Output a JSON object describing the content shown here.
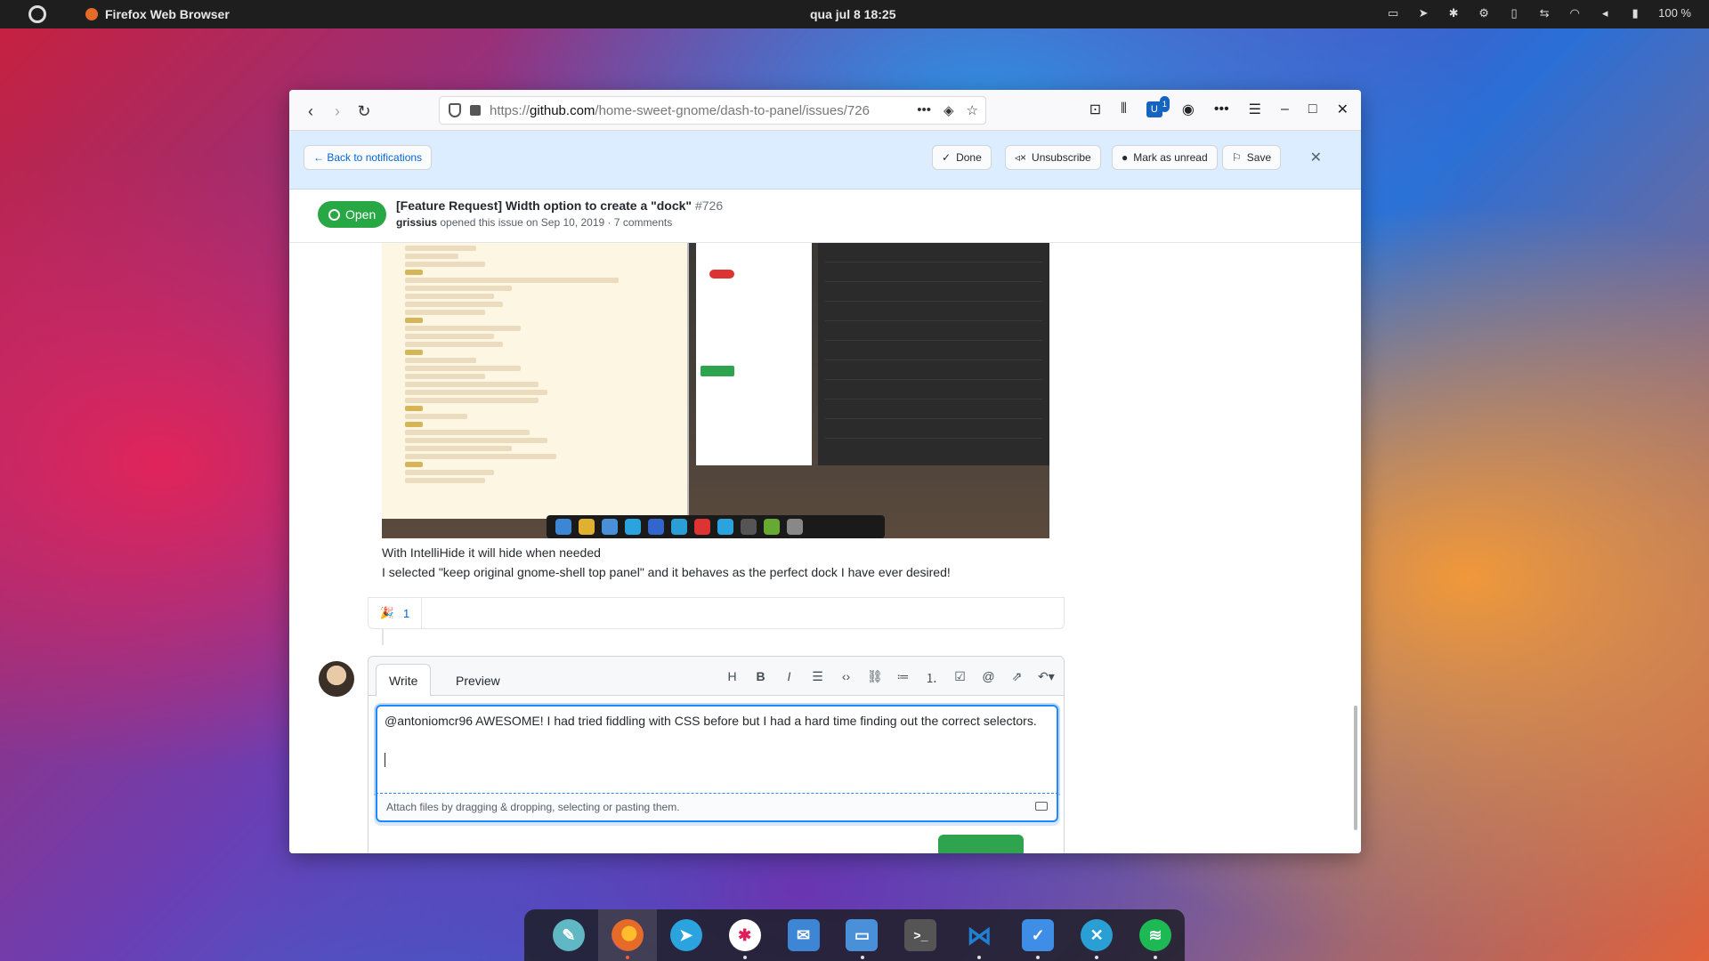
{
  "topbar": {
    "app_name": "Firefox Web Browser",
    "clock": "qua jul 8  18:25",
    "battery": "100 %"
  },
  "browser": {
    "url_prefix": "https://",
    "url_domain": "github.com",
    "url_path": "/home-sweet-gnome/dash-to-panel/issues/726",
    "extension_badge": "1"
  },
  "notifications": {
    "back": "← Back to notifications",
    "done": "Done",
    "unsubscribe": "Unsubscribe",
    "mark_unread": "Mark as unread",
    "save": "Save"
  },
  "issue": {
    "state": "Open",
    "title": "[Feature Request] Width option to create a \"dock\"",
    "number": "#726",
    "author": "grissius",
    "meta": "opened this issue on Sep 10, 2019 · 7 comments"
  },
  "comment": {
    "line1": "With IntelliHide it will hide when needed",
    "line2": "I selected \"keep original gnome-shell top panel\" and it behaves as the perfect dock I have ever desired!",
    "reaction_emoji": "🎉",
    "reaction_count": "1"
  },
  "editor": {
    "tab_write": "Write",
    "tab_preview": "Preview",
    "text": "@antoniomcr96 AWESOME! I had tried fiddling with CSS before but I had a hard time finding out the correct selectors.",
    "attach_hint": "Attach files by dragging & dropping, selecting or pasting them."
  },
  "colors": {
    "accent": "#0366d6",
    "open_green": "#28a745",
    "notif_bg": "#dbedff"
  },
  "dock_icons": [
    {
      "name": "gnome-tweaks-icon",
      "color": "#5fb8c4"
    },
    {
      "name": "firefox-icon",
      "color": "#e66a28"
    },
    {
      "name": "telegram-icon",
      "color": "#2aa3df"
    },
    {
      "name": "slack-icon",
      "color": "#ffffff"
    },
    {
      "name": "mail-icon",
      "color": "#3d86d6"
    },
    {
      "name": "files-icon",
      "color": "#4a90d9"
    },
    {
      "name": "terminal-icon",
      "color": "#555555"
    },
    {
      "name": "vscode-icon",
      "color": "#1f7fd0"
    },
    {
      "name": "todo-icon",
      "color": "#3e8ee8"
    },
    {
      "name": "bitwarden-icon",
      "color": "#2a9fd6"
    },
    {
      "name": "spotify-icon",
      "color": "#1db954"
    }
  ]
}
